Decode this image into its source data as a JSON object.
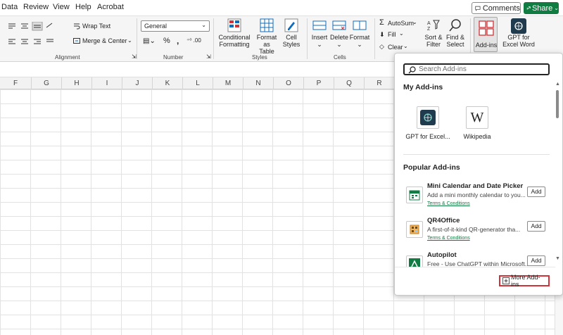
{
  "menu": [
    "Data",
    "Review",
    "View",
    "Help",
    "Acrobat"
  ],
  "header_buttons": {
    "comments": "Comments",
    "share": "Share"
  },
  "ribbon": {
    "alignment": {
      "wrap_text": "Wrap Text",
      "merge_center": "Merge & Center",
      "label": "Alignment"
    },
    "number": {
      "format": "General",
      "label": "Number"
    },
    "styles": {
      "conditional_formatting": [
        "Conditional",
        "Formatting"
      ],
      "format_as_table": [
        "Format as",
        "Table"
      ],
      "cell_styles": [
        "Cell",
        "Styles"
      ],
      "label": "Styles"
    },
    "cells": {
      "insert": "Insert",
      "delete": "Delete",
      "format": "Format",
      "label": "Cells"
    },
    "editing": {
      "autosum": "AutoSum",
      "fill": "Fill",
      "clear": "Clear",
      "sort_filter": [
        "Sort &",
        "Filter"
      ],
      "find_select": [
        "Find &",
        "Select"
      ]
    },
    "addins": {
      "label": "Add-ins"
    },
    "gpt": {
      "label": [
        "GPT for",
        "Excel Word"
      ]
    }
  },
  "columns": [
    "F",
    "G",
    "H",
    "I",
    "J",
    "K",
    "L",
    "M",
    "N",
    "O",
    "P",
    "Q",
    "R"
  ],
  "popup": {
    "search_placeholder": "Search Add-ins",
    "my_addins_title": "My Add-ins",
    "my_addins": [
      {
        "name": "GPT for Excel...",
        "icon": "gpt-icon"
      },
      {
        "name": "Wikipedia",
        "icon": "wikipedia-icon"
      }
    ],
    "popular_title": "Popular Add-ins",
    "popular": [
      {
        "name": "Mini Calendar and Date Picker",
        "desc": "Add a mini monthly calendar to you...",
        "terms": "Terms & Conditions",
        "add": "Add"
      },
      {
        "name": "QR4Office",
        "desc": "A first-of-it-kind QR-generator tha...",
        "terms": "Terms & Conditions",
        "add": "Add"
      },
      {
        "name": "Autopilot",
        "desc": "Free - Use ChatGPT within Microsoft...",
        "terms": "",
        "add": "Add"
      }
    ],
    "more_addins": "More Add-ins"
  },
  "colors": {
    "accent_green": "#107c41",
    "highlight_red": "#d13438"
  }
}
